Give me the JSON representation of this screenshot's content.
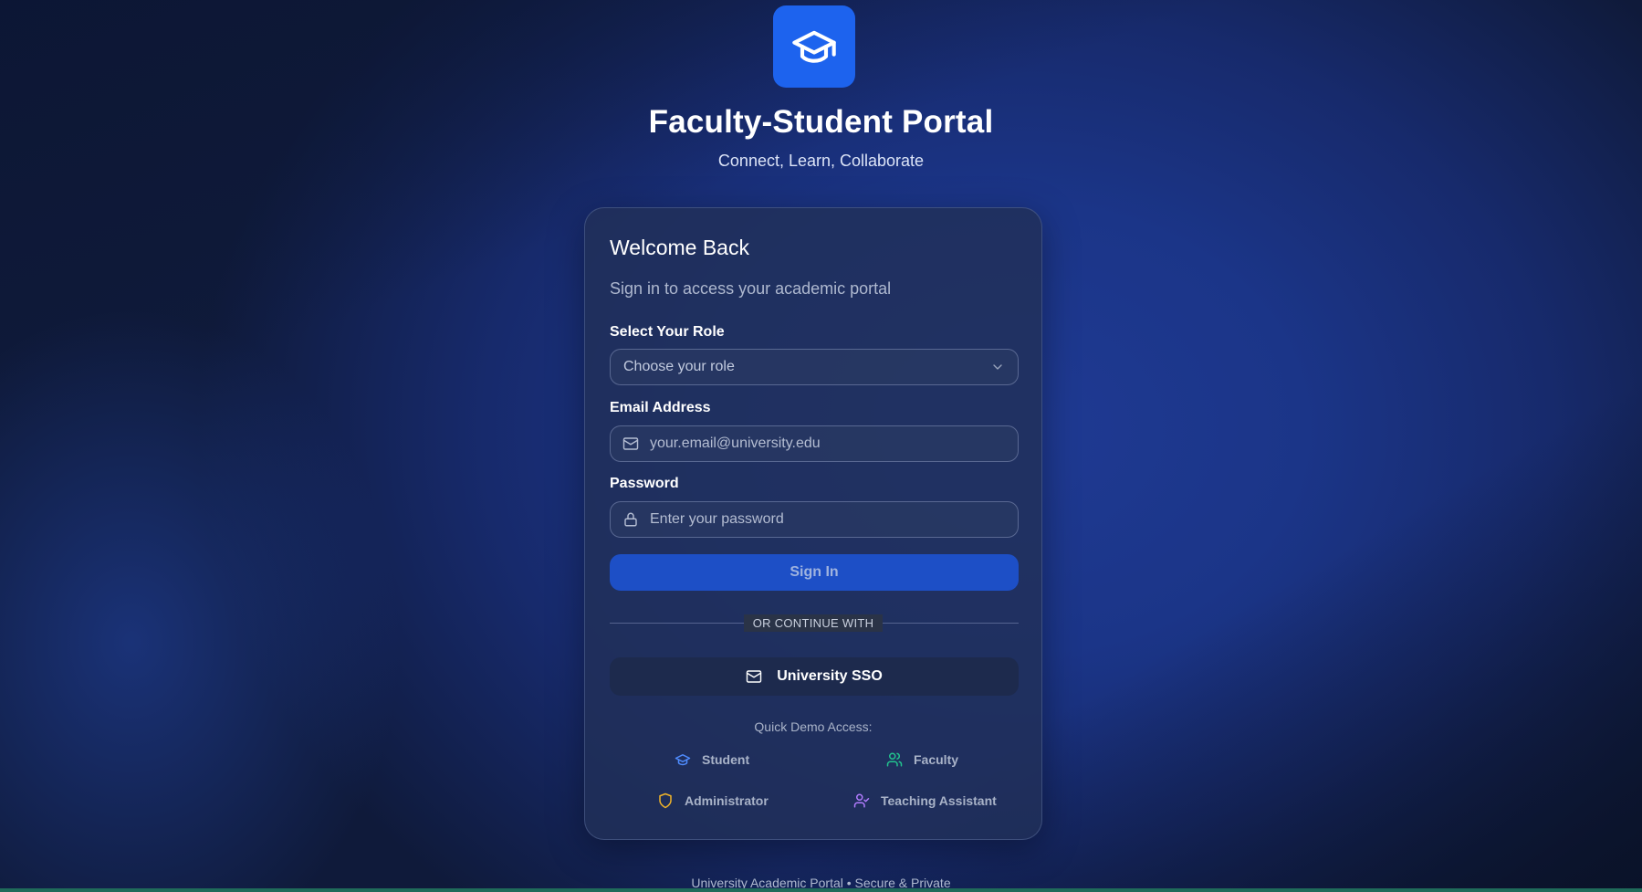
{
  "header": {
    "logo_icon": "graduation-cap-icon",
    "title": "Faculty-Student Portal",
    "subtitle": "Connect, Learn, Collaborate"
  },
  "login_card": {
    "heading": "Welcome Back",
    "subheading": "Sign in to access your academic portal",
    "role": {
      "label": "Select Your Role",
      "placeholder": "Choose your role"
    },
    "email": {
      "label": "Email Address",
      "placeholder": "your.email@university.edu",
      "icon": "mail-icon"
    },
    "password": {
      "label": "Password",
      "placeholder": "Enter your password",
      "icon": "lock-icon"
    },
    "sign_in_label": "Sign In",
    "divider_text": "OR CONTINUE WITH",
    "sso_label": "University SSO",
    "quick_demo": {
      "label": "Quick Demo Access:",
      "items": [
        {
          "label": "Student",
          "icon": "graduation-cap-icon",
          "color": "#4f8cff"
        },
        {
          "label": "Faculty",
          "icon": "users-icon",
          "color": "#22c38e"
        },
        {
          "label": "Administrator",
          "icon": "shield-icon",
          "color": "#f0b429"
        },
        {
          "label": "Teaching Assistant",
          "icon": "user-check-icon",
          "color": "#b27cff"
        }
      ]
    }
  },
  "footer": {
    "text": "University Academic Portal • Secure & Private"
  },
  "colors": {
    "accent": "#1d63ee",
    "button": "#1d4fc6"
  }
}
